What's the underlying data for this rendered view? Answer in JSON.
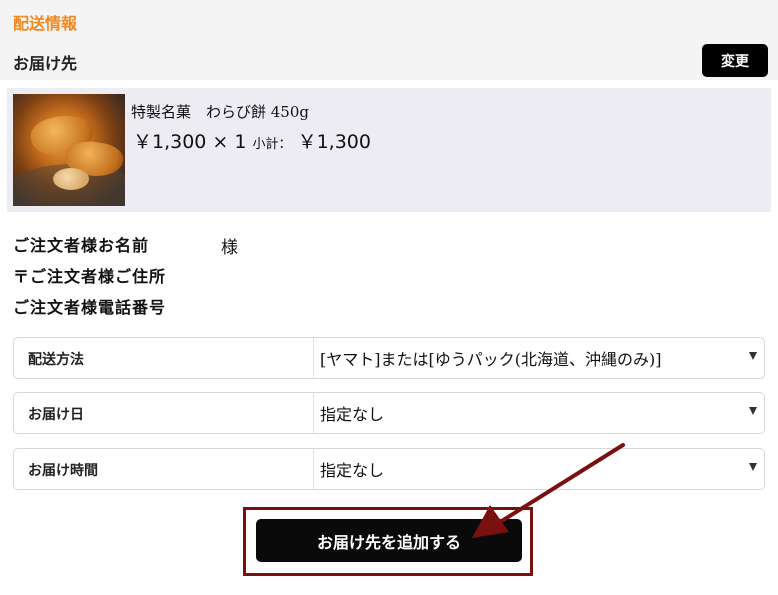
{
  "header": {
    "section_title": "配送情報",
    "destination_label": "お届け先",
    "change_button": "変更"
  },
  "product": {
    "name": "特製名菓　わらび餅 450g",
    "price_qty": "￥1,300 × 1 ",
    "subtotal_label": "小計：",
    "subtotal_value": "￥1,300"
  },
  "orderer": {
    "name_label": "ご注文者様お名前",
    "name_value": "様",
    "address_label": "〒ご注文者様ご住所",
    "phone_label": "ご注文者様電話番号"
  },
  "options": [
    {
      "label": "配送方法",
      "value": "[ヤマト]または[ゆうパック(北海道、沖縄のみ)]"
    },
    {
      "label": "お届け日",
      "value": "指定なし"
    },
    {
      "label": "お届け時間",
      "value": "指定なし"
    }
  ],
  "actions": {
    "add_destination": "お届け先を追加する"
  },
  "colors": {
    "accent_orange": "#f08a24",
    "annotation_red": "#7a1010",
    "button_black": "#0a0a0a"
  }
}
